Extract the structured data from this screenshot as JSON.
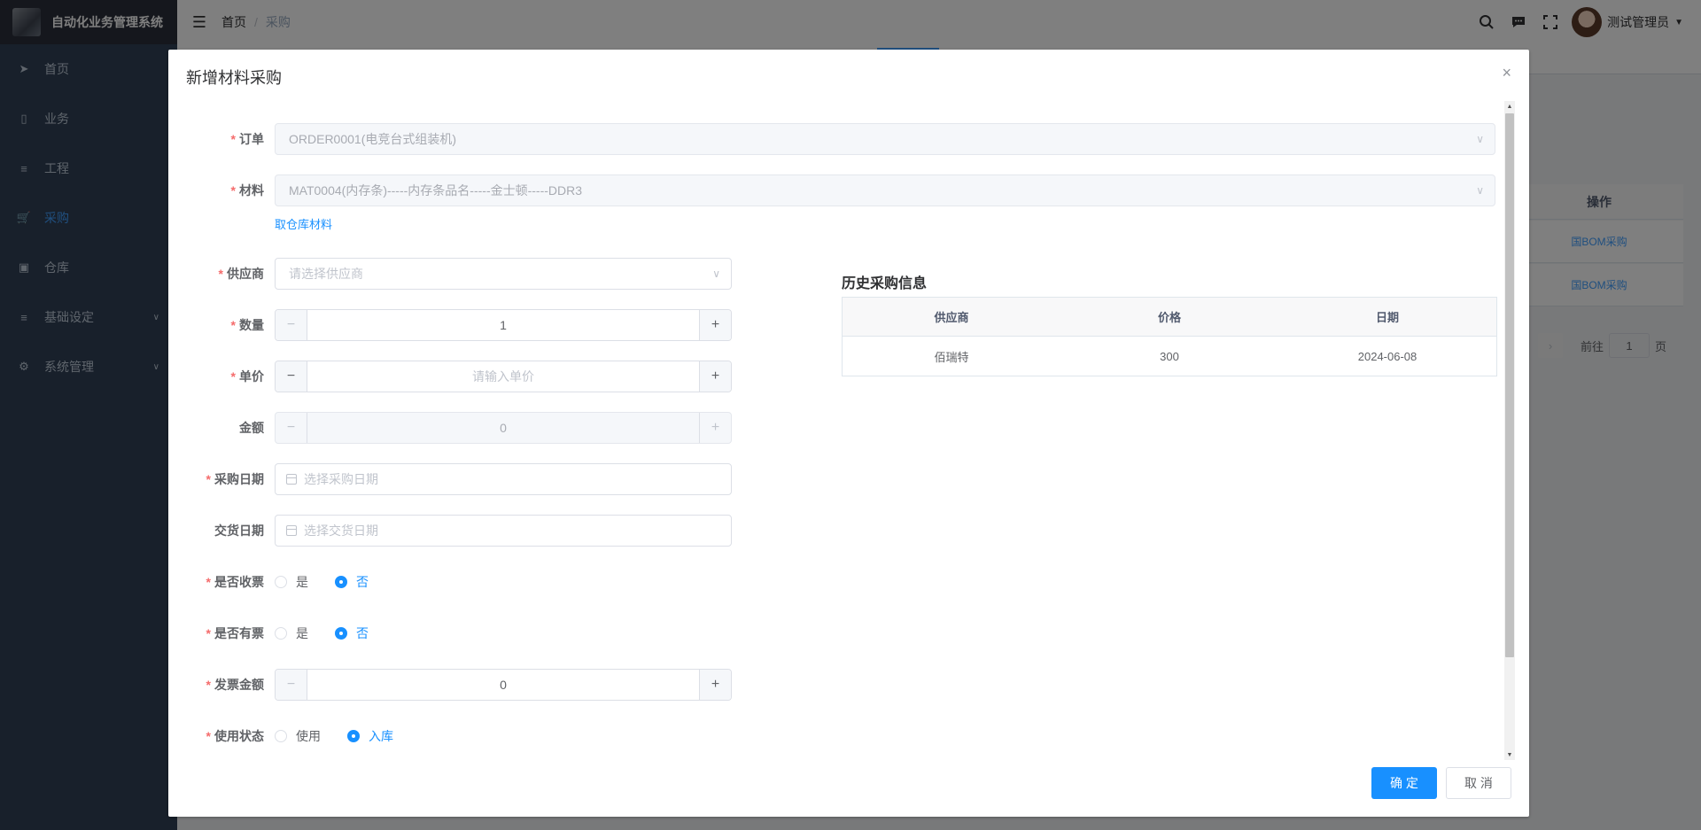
{
  "app": {
    "title": "自动化业务管理系统"
  },
  "sidebar": {
    "items": [
      {
        "label": "首页",
        "icon": "send-icon"
      },
      {
        "label": "业务",
        "icon": "document-icon"
      },
      {
        "label": "工程",
        "icon": "sliders-icon"
      },
      {
        "label": "采购",
        "icon": "cart-icon",
        "active": true
      },
      {
        "label": "仓库",
        "icon": "box-icon"
      },
      {
        "label": "基础设定",
        "icon": "sliders-icon",
        "has_children": true
      },
      {
        "label": "系统管理",
        "icon": "gear-icon",
        "has_children": true
      }
    ]
  },
  "navbar": {
    "breadcrumb": [
      "首页",
      "采购"
    ],
    "separator": "/",
    "username": "测试管理员"
  },
  "background": {
    "table_header": "操作",
    "row_actions": [
      "国BOM采购",
      "国BOM采购"
    ],
    "pagination": {
      "goto_label": "前往",
      "page": "1",
      "page_suffix": "页"
    }
  },
  "dialog": {
    "title": "新增材料采购",
    "close": "×",
    "form": {
      "order": {
        "label": "订单",
        "value": "ORDER0001(电竞台式组装机)"
      },
      "material": {
        "label": "材料",
        "value": "MAT0004(内存条)-----内存条品名-----金士顿-----DDR3"
      },
      "take_stock_link": "取仓库材料",
      "supplier": {
        "label": "供应商",
        "placeholder": "请选择供应商"
      },
      "quantity": {
        "label": "数量",
        "value": "1"
      },
      "unit_price": {
        "label": "单价",
        "placeholder": "请输入单价"
      },
      "amount": {
        "label": "金额",
        "value": "0"
      },
      "purchase_date": {
        "label": "采购日期",
        "placeholder": "选择采购日期"
      },
      "delivery_date": {
        "label": "交货日期",
        "placeholder": "选择交货日期"
      },
      "invoice_received": {
        "label": "是否收票",
        "options": [
          "是",
          "否"
        ],
        "selected": "否"
      },
      "has_invoice": {
        "label": "是否有票",
        "options": [
          "是",
          "否"
        ],
        "selected": "否"
      },
      "invoice_amount": {
        "label": "发票金额",
        "value": "0"
      },
      "usage_status": {
        "label": "使用状态",
        "options": [
          "使用",
          "入库"
        ],
        "selected": "入库"
      }
    },
    "history": {
      "title": "历史采购信息",
      "columns": [
        "供应商",
        "价格",
        "日期"
      ],
      "rows": [
        [
          "佰瑞特",
          "300",
          "2024-06-08"
        ]
      ]
    },
    "buttons": {
      "confirm": "确 定",
      "cancel": "取 消"
    }
  },
  "colors": {
    "primary": "#1890ff",
    "sidebar": "#304156",
    "required": "#f56c6c"
  }
}
